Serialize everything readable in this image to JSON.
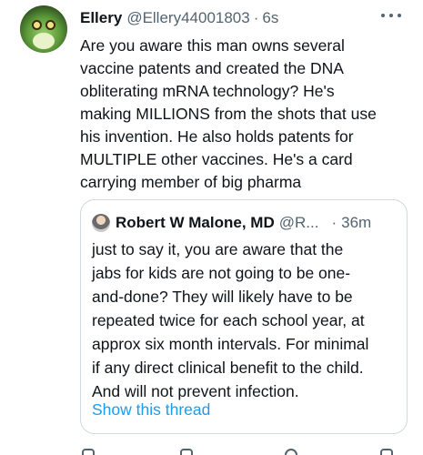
{
  "tweet": {
    "author_name": "Ellery",
    "author_handle": "@Ellery44001803",
    "separator": "·",
    "time": "6s",
    "more_icon": "more-horizontal-icon",
    "text_lines": [
      "Are you aware this man owns several",
      "vaccine patents and created the DNA",
      "obliterating mRNA technology? He's",
      "making MILLIONS from the shots that use",
      "his invention. He also holds patents for",
      "MULTIPLE other vaccines.  He's a card",
      "carrying member of big pharma"
    ]
  },
  "quote": {
    "author_name": "Robert W Malone, MD",
    "author_handle": "@R...",
    "separator": "·",
    "time": "36m",
    "text_lines": [
      "just to say it, you are aware that the",
      "jabs for kids are not going to be one-",
      "and-done?  They will likely have to be",
      "repeated twice for each school year, at",
      "approx six month intervals. For minimal",
      "if any direct clinical benefit to the child.",
      "And will not prevent infection."
    ],
    "link_label": "Show this thread"
  },
  "colors": {
    "text": "#0f1419",
    "secondary": "#536471",
    "link": "#1d9bf0",
    "border": "#cfd9de"
  }
}
